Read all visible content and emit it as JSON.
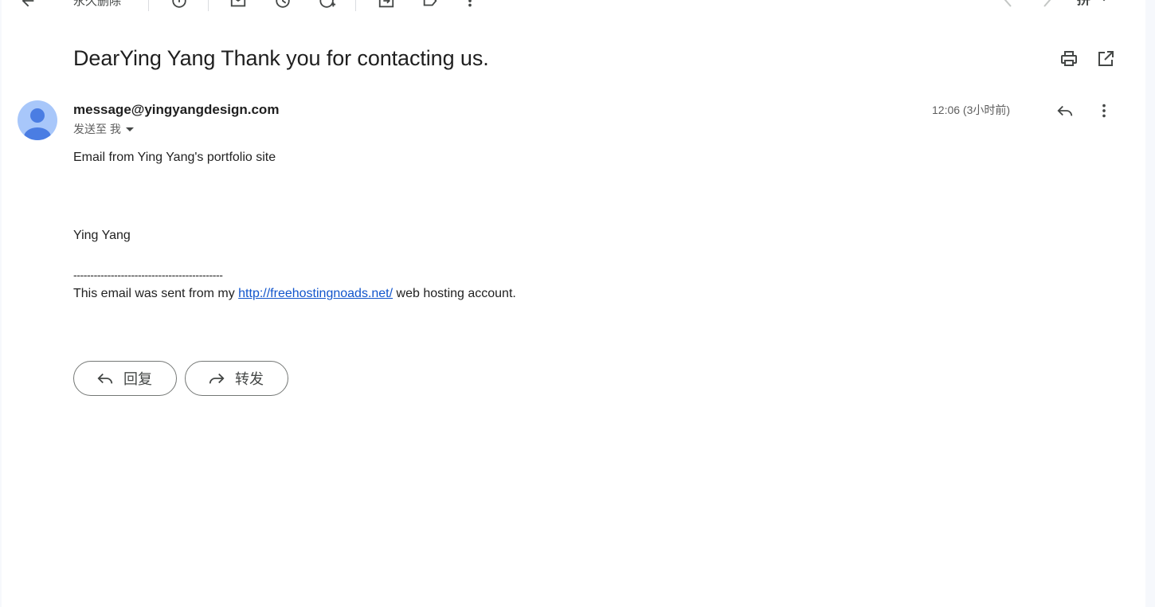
{
  "toolbar": {
    "back_icon": "arrow-left-icon",
    "delete_forever_label": "永久删除",
    "icons": [
      "report-spam-icon",
      "mark-unread-icon",
      "snooze-icon",
      "add-task-icon",
      "move-to-icon",
      "label-icon",
      "more-vert-icon"
    ],
    "nav_icons": [
      "chevron-left-icon",
      "chevron-right-icon"
    ],
    "input_method_label": "拼"
  },
  "email": {
    "subject": "DearYing Yang Thank you for contacting us.",
    "sender": "message@yingyangdesign.com",
    "to_label": "发送至 我",
    "time": "12:06 (3小时前)",
    "body": {
      "line1": "Email from Ying Yang's portfolio site",
      "name": "Ying Yang",
      "separator": "--------------------------------------------",
      "footer_prefix": "This email was sent from my ",
      "footer_link": "http://freehostingnoads.net/",
      "footer_suffix": " web hosting account."
    }
  },
  "actions": {
    "reply_label": "回复",
    "forward_label": "转发"
  }
}
